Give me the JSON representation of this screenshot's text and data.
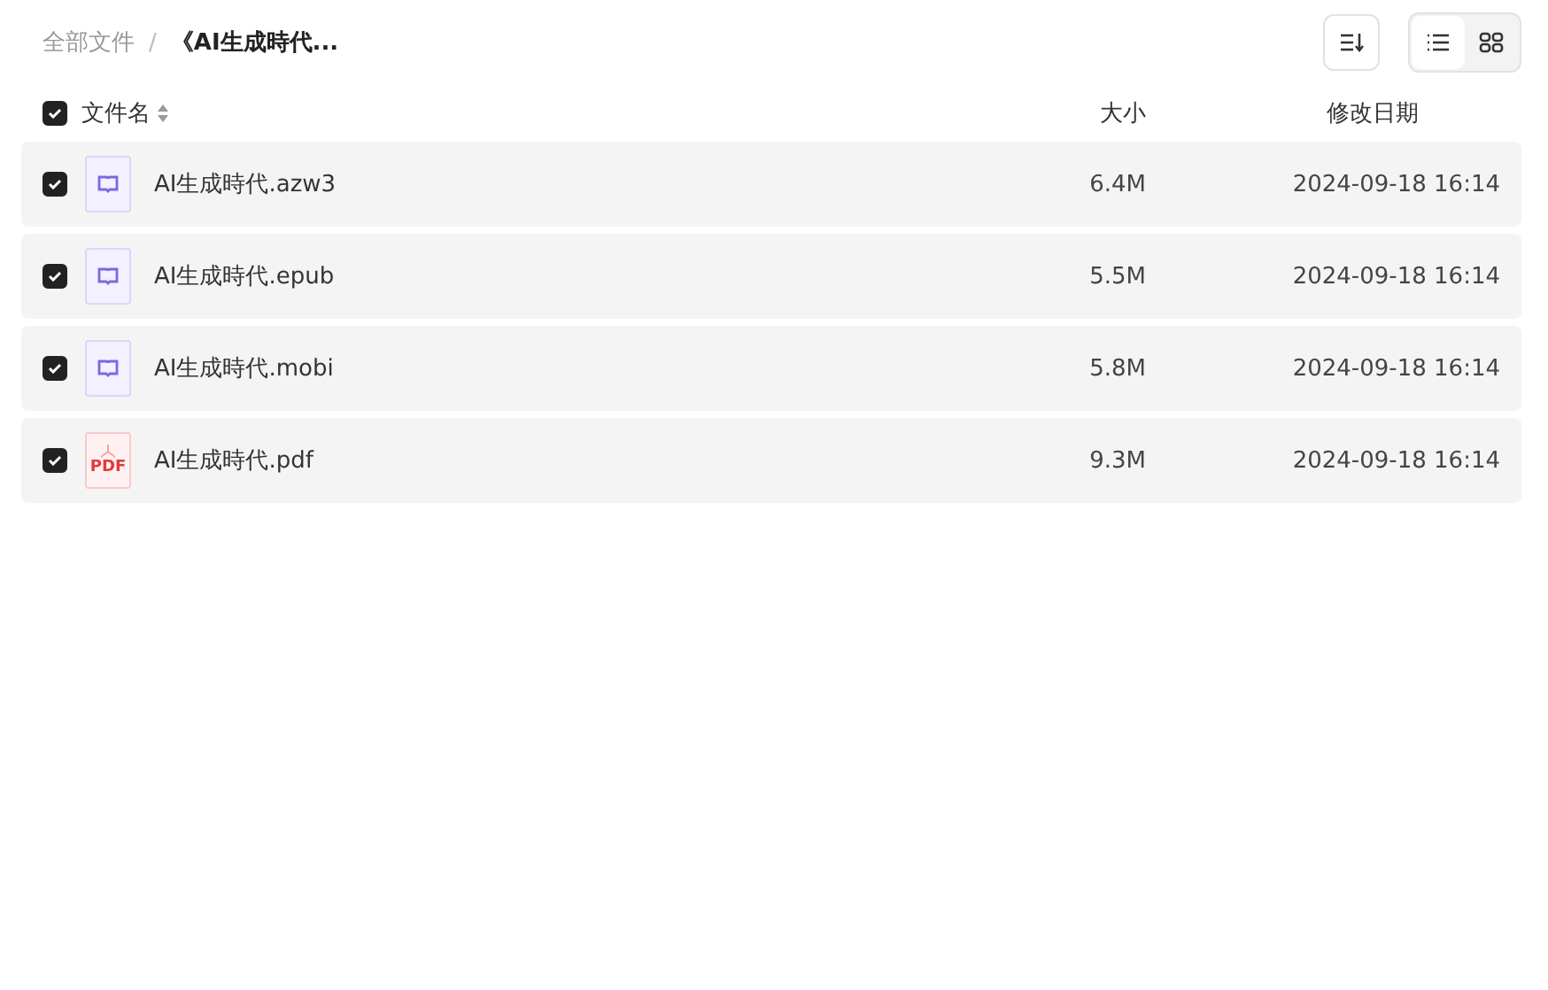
{
  "breadcrumb_separator": "/",
  "breadcrumb": [
    {
      "label": "全部文件",
      "current": false
    },
    {
      "label": "《AI生成時代...",
      "current": true
    }
  ],
  "view_modes": [
    {
      "kind": "list",
      "selected": true
    },
    {
      "kind": "grid",
      "selected": false
    }
  ],
  "table": {
    "select_all_checked": true,
    "columns": [
      "文件名",
      "大小",
      "修改日期"
    ],
    "rows": [
      {
        "checked": true,
        "kind": "ebook",
        "name": "AI生成時代.azw3",
        "size": "6.4M",
        "date": "2024-09-18 16:14"
      },
      {
        "checked": true,
        "kind": "ebook",
        "name": "AI生成時代.epub",
        "size": "5.5M",
        "date": "2024-09-18 16:14"
      },
      {
        "checked": true,
        "kind": "ebook",
        "name": "AI生成時代.mobi",
        "size": "5.8M",
        "date": "2024-09-18 16:14"
      },
      {
        "checked": true,
        "kind": "pdf",
        "badge": "PDF",
        "name": "AI生成時代.pdf",
        "size": "9.3M",
        "date": "2024-09-18 16:14"
      }
    ]
  }
}
